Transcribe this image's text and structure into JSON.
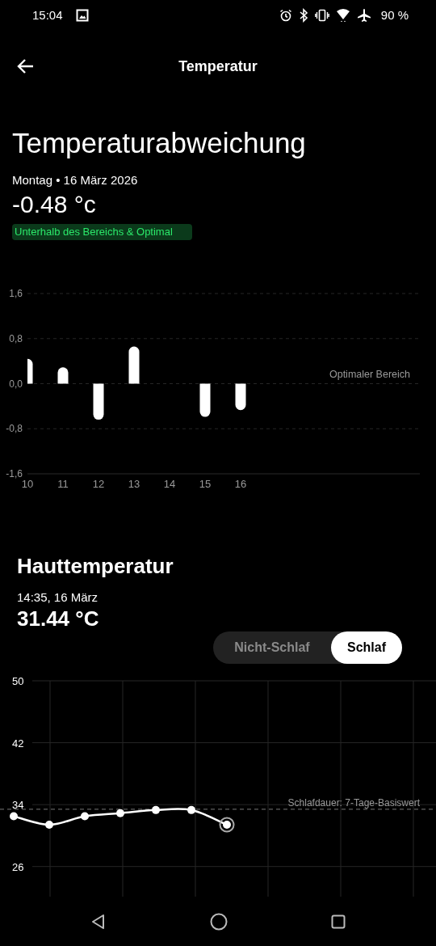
{
  "status_bar": {
    "time": "15:04",
    "battery": "90 %"
  },
  "app_bar": {
    "title": "Temperatur"
  },
  "deviation": {
    "title": "Temperaturabweichung",
    "date_line": "Montag • 16 März 2026",
    "value": "-0.48 °c",
    "status_tag": "Unterhalb des Bereichs & Optimal",
    "chart_data": {
      "type": "bar",
      "categories": [
        "10",
        "11",
        "12",
        "13",
        "14",
        "15",
        "16"
      ],
      "values": [
        0.44,
        0.29,
        -0.64,
        0.66,
        null,
        -0.59,
        -0.47
      ],
      "ylim": [
        -1.6,
        1.6
      ],
      "yticks": [
        {
          "value": 1.6,
          "label": "1,6"
        },
        {
          "value": 0.8,
          "label": "0,8"
        },
        {
          "value": 0,
          "label": "0,0"
        },
        {
          "value": -0.8,
          "label": "-0,8"
        },
        {
          "value": -1.6,
          "label": "-1,6"
        }
      ],
      "grid": true,
      "annotations": [
        "Optimaler Bereich"
      ]
    }
  },
  "skin": {
    "title": "Hauttemperatur",
    "time": "14:35, 16 März",
    "value": "31.44 °C",
    "toggle": [
      {
        "label": "Nicht-Schlaf",
        "selected": false
      },
      {
        "label": "Schlaf",
        "selected": true
      }
    ],
    "chart_data": {
      "type": "line",
      "series": [
        {
          "color": "#ffffff",
          "marker": "o",
          "values": [
            32.5,
            31.4,
            32.5,
            32.9,
            33.3,
            33.3,
            31.4
          ]
        }
      ],
      "ylim": [
        22,
        50
      ],
      "yticks": [
        26,
        34,
        42,
        50
      ],
      "grid": true,
      "ref_lines": [
        {
          "axis": "y",
          "value": 33.4
        }
      ],
      "annotations": [
        "Schlafdauer: 7-Tage-Basiswert"
      ]
    }
  }
}
